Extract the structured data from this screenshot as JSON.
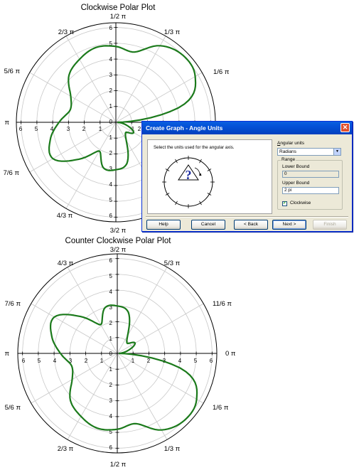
{
  "top_chart": {
    "title": "Clockwise Polar Plot",
    "angle_labels": [
      "π",
      "5/6 π",
      "2/3 π",
      "1/2 π",
      "1/3 π",
      "1/6 π",
      "4/3 π",
      "3/2 π",
      "7/6 π"
    ],
    "left_ticks": [
      "6",
      "5",
      "4",
      "3",
      "2",
      "1"
    ],
    "right_ticks": [
      "1",
      "2"
    ],
    "up_ticks": [
      "6",
      "5",
      "4",
      "3",
      "2",
      "1",
      "0"
    ],
    "down_ticks": [
      "1",
      "2",
      "3",
      "4",
      "5",
      "6"
    ]
  },
  "bottom_chart": {
    "title": "Counter Clockwise Polar Plot",
    "angle_labels": [
      "3/2 π",
      "4/3 π",
      "5/3 π",
      "7/6 π",
      "11/6 π",
      "π",
      "0 π",
      "5/6 π",
      "1/6 π",
      "2/3 π",
      "1/3 π",
      "1/2 π"
    ],
    "left_ticks": [
      "6",
      "5",
      "4",
      "3",
      "2",
      "1"
    ],
    "right_ticks": [
      "1",
      "2",
      "3",
      "4",
      "5",
      "6"
    ],
    "up_ticks": [
      "6",
      "5",
      "4",
      "3",
      "2",
      "1",
      "0"
    ],
    "down_ticks": [
      "1",
      "2",
      "3",
      "4",
      "5",
      "6"
    ]
  },
  "chart_data": [
    {
      "type": "line",
      "title": "Clockwise Polar Plot",
      "coordinate_system": "polar",
      "direction": "clockwise",
      "rlim": [
        0,
        6.3
      ],
      "series": [
        {
          "theta_pi": [
            0,
            0.083,
            0.167,
            0.25,
            0.333,
            0.417,
            0.5,
            0.583,
            0.667,
            0.75,
            0.833,
            0.917,
            1.0,
            1.083,
            1.167,
            1.25,
            1.333,
            1.417,
            1.5,
            1.583,
            1.667,
            1.75,
            1.833,
            1.917,
            2.0
          ],
          "r": [
            0.1,
            0.7,
            1.3,
            0.9,
            1.3,
            2.7,
            3.0,
            3.0,
            2.1,
            3.3,
            4.6,
            4.3,
            3.6,
            3.0,
            3.3,
            4.2,
            4.6,
            4.9,
            4.8,
            4.6,
            5.6,
            6.0,
            5.8,
            4.5,
            0.1
          ],
          "color": "#1b7a1b"
        }
      ]
    },
    {
      "type": "line",
      "title": "Counter Clockwise Polar Plot",
      "coordinate_system": "polar",
      "direction": "counter-clockwise",
      "rlim": [
        0,
        6.3
      ],
      "series": [
        {
          "theta_pi": [
            0,
            0.083,
            0.167,
            0.25,
            0.333,
            0.417,
            0.5,
            0.583,
            0.667,
            0.75,
            0.833,
            0.917,
            1.0,
            1.083,
            1.167,
            1.25,
            1.333,
            1.417,
            1.5,
            1.583,
            1.667,
            1.75,
            1.833,
            1.917,
            2.0
          ],
          "r": [
            0.1,
            0.7,
            1.3,
            0.9,
            1.3,
            2.7,
            3.0,
            3.0,
            2.1,
            3.3,
            4.6,
            4.3,
            3.6,
            3.0,
            3.3,
            4.2,
            4.6,
            4.9,
            4.8,
            4.6,
            5.6,
            6.0,
            5.8,
            4.5,
            0.1
          ],
          "color": "#1b7a1b"
        }
      ]
    }
  ],
  "dialog": {
    "title": "Create Graph - Angle Units",
    "instruction": "Select the units used for the angular axis.",
    "preview_icon": "question-mark-icon",
    "angular_units_label": "Angular units",
    "angular_units_value": "Radians",
    "range_label": "Range",
    "lower_bound_label": "Lower Bound",
    "lower_bound_value": "0",
    "upper_bound_label": "Upper Bound",
    "upper_bound_value": "2 pi",
    "clockwise_label": "Clockwise",
    "clockwise_checked": true,
    "buttons": {
      "help": "Help",
      "cancel": "Cancel",
      "back": "< Back",
      "next": "Next >",
      "finish": "Finish"
    }
  }
}
